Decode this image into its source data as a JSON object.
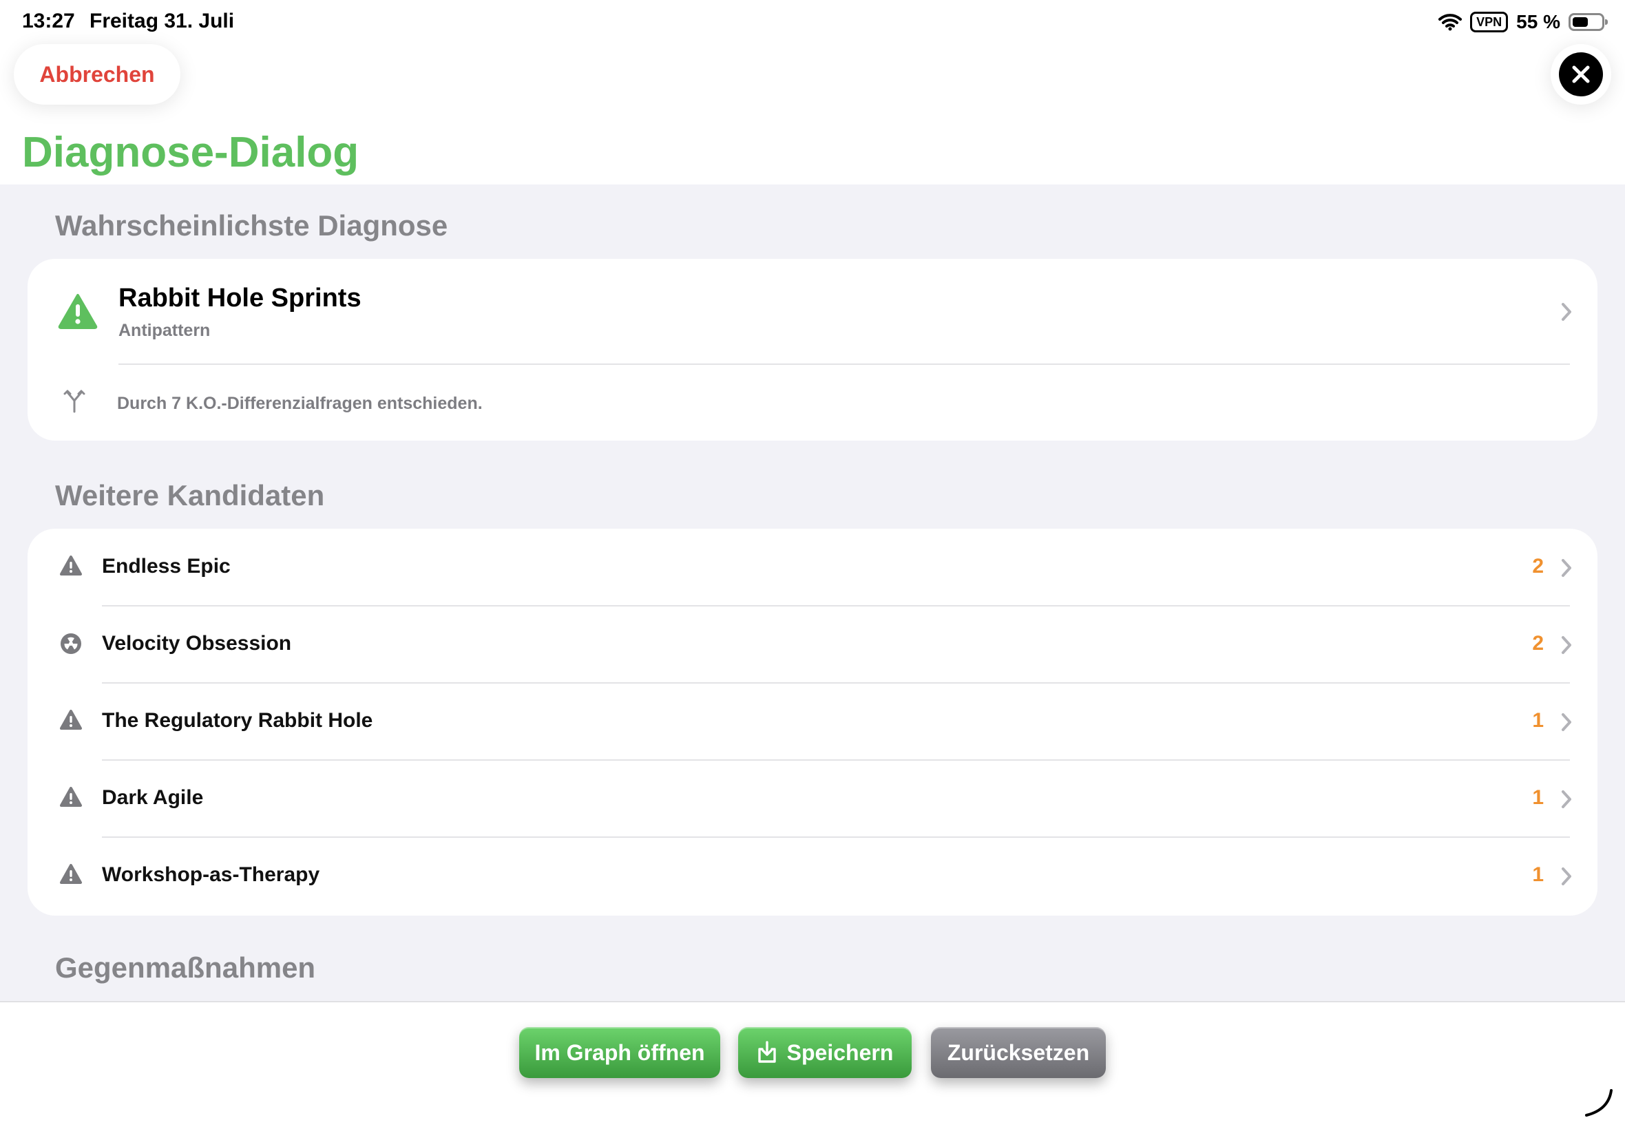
{
  "status_bar": {
    "time": "13:27",
    "date": "Freitag 31. Juli",
    "vpn": "VPN",
    "battery": "55 %",
    "battery_level": 0.55
  },
  "header": {
    "cancel_label": "Abbrechen",
    "title": "Diagnose-Dialog"
  },
  "sections": {
    "likely_title": "Wahrscheinlichste Diagnose",
    "others_title": "Weitere Kandidaten",
    "counter_title": "Gegenmaßnahmen"
  },
  "likely": {
    "title": "Rabbit Hole Sprints",
    "subtitle": "Antipattern",
    "info": "Durch 7 K.O.-Differenzialfragen entschieden.",
    "icon": "warning-triangle-icon",
    "accent": "#5ebf5e"
  },
  "candidates": [
    {
      "label": "Endless Epic",
      "count": "2",
      "icon": "warning-triangle-icon"
    },
    {
      "label": "Velocity Obsession",
      "count": "2",
      "icon": "radiation-icon"
    },
    {
      "label": "The Regulatory Rabbit Hole",
      "count": "1",
      "icon": "warning-triangle-icon"
    },
    {
      "label": "Dark Agile",
      "count": "1",
      "icon": "warning-triangle-icon"
    },
    {
      "label": "Workshop-as-Therapy",
      "count": "1",
      "icon": "warning-triangle-icon"
    }
  ],
  "toolbar": {
    "open_graph_label": "Im Graph öffnen",
    "save_label": "Speichern",
    "reset_label": "Zurücksetzen"
  },
  "colors": {
    "accent_green": "#5ebf5e",
    "cancel_red": "#e0443b",
    "count_orange": "#f0912f",
    "background": "#f2f2f7"
  }
}
